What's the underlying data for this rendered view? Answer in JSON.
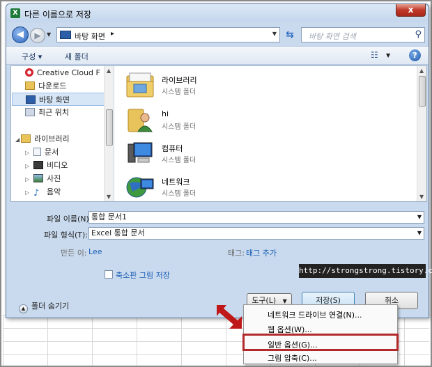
{
  "window": {
    "title": "다른 이름으로 저장",
    "app_icon": "X",
    "close_label": "x"
  },
  "nav": {
    "back_symbol": "◀",
    "forward_symbol": "▶",
    "address": "바탕 화면",
    "address_chevron": "▸",
    "search_placeholder": "바탕 화면 검색",
    "refresh_symbol": "⇆"
  },
  "toolbar": {
    "organize": "구성 ▾",
    "new_folder": "새 폴더",
    "help": "?"
  },
  "sidebar": {
    "items": [
      {
        "label": "Creative Cloud F",
        "icon": "creative-cloud-icon"
      },
      {
        "label": "다운로드",
        "icon": "downloads-icon"
      },
      {
        "label": "바탕 화면",
        "icon": "desktop-icon",
        "selected": true
      },
      {
        "label": "최근 위치",
        "icon": "recent-places-icon"
      },
      {
        "label": "라이브러리",
        "icon": "library-icon"
      },
      {
        "label": "문서",
        "icon": "documents-icon"
      },
      {
        "label": "비디오",
        "icon": "video-icon"
      },
      {
        "label": "사진",
        "icon": "pictures-icon"
      },
      {
        "label": "음악",
        "icon": "music-icon"
      }
    ]
  },
  "files": [
    {
      "name": "라이브러리",
      "type": "시스템 폴더",
      "icon": "library-folder-icon"
    },
    {
      "name": "hi",
      "type": "시스템 폴더",
      "icon": "user-folder-icon"
    },
    {
      "name": "컴퓨터",
      "type": "시스템 폴더",
      "icon": "computer-icon"
    },
    {
      "name": "네트워크",
      "type": "시스템 폴더",
      "icon": "network-icon"
    }
  ],
  "form": {
    "filename_label": "파일 이름(N):",
    "filename_value": "통합 문서1",
    "filetype_label": "파일 형식(T):",
    "filetype_value": "Excel 통합 문서",
    "author_label": "만든 이:",
    "author_value": "Lee",
    "tags_label": "태그:",
    "tags_value": "태그 추가",
    "thumbnail_label": "축소판 그림 저장",
    "thumbnail_checked": false
  },
  "watermark": "http://strongstrong.tistory.com",
  "footer": {
    "hide_folders": "폴더 숨기기",
    "tools": "도구(L)",
    "save": "저장(S)",
    "cancel": "취소"
  },
  "tools_menu": {
    "items": [
      "네트워크 드라이브 연결(N)...",
      "웹 옵션(W)...",
      "일반 옵션(G)...",
      "그림 압축(C)..."
    ],
    "highlighted_index": 2
  },
  "colors": {
    "dialog_bg": "#c9daee",
    "highlight_border": "#b22a2a",
    "close_red": "#c0392b"
  }
}
